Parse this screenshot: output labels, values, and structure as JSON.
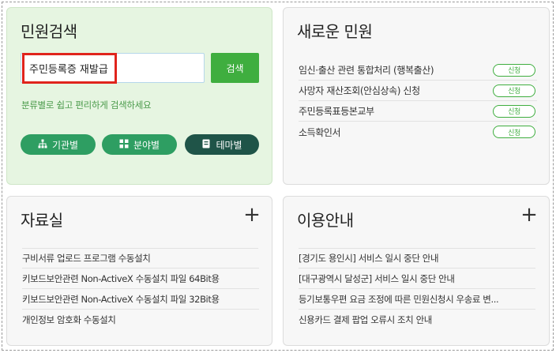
{
  "search": {
    "title": "민원검색",
    "input_value": "주민등록증 재발급",
    "button_label": "검색",
    "hint": "분류별로 쉽고 편리하게 검색하세요",
    "categories": [
      {
        "label": "기관별",
        "icon": "org-chart-icon"
      },
      {
        "label": "분야별",
        "icon": "grid-icon"
      },
      {
        "label": "테마별",
        "icon": "book-icon"
      }
    ]
  },
  "new_complaints": {
    "title": "새로운 민원",
    "items": [
      {
        "label": "임신·출산 관련 통합처리 (행복출산)",
        "badge": "신청"
      },
      {
        "label": "사망자 재산조회(안심상속) 신청",
        "badge": "신청"
      },
      {
        "label": "주민등록표등본교부",
        "badge": "신청"
      },
      {
        "label": "소득확인서",
        "badge": "신청"
      }
    ]
  },
  "resources": {
    "title": "자료실",
    "more_icon": "plus-icon",
    "items": [
      "구비서류 업로드 프로그램 수동설치",
      "키보드보안관련 Non-ActiveX 수동설치 파일 64Bit용",
      "키보드보안관련 Non-ActiveX 수동설치 파일 32Bit용",
      "개인정보 암호화 수동설치"
    ]
  },
  "guide": {
    "title": "이용안내",
    "more_icon": "plus-icon",
    "items": [
      "[경기도 용인시] 서비스 일시 중단 안내",
      "[대구광역시 달성군] 서비스 일시 중단 안내",
      "등기보통우편 요금 조정에 따른 민원신청시 우송료 변...",
      "신용카드 결제 팝업 오류시 조치 안내"
    ]
  }
}
